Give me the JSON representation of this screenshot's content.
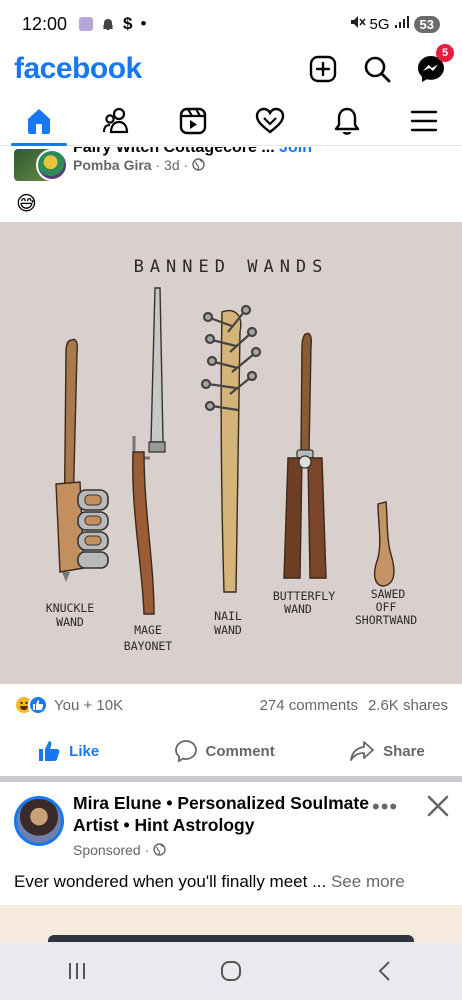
{
  "status_bar": {
    "time": "12:00",
    "dollar": "$",
    "dot": "•",
    "network": "5G",
    "battery": "53"
  },
  "header": {
    "logo": "facebook",
    "messenger_badge": "5"
  },
  "tabs": [
    "home",
    "friends",
    "video",
    "dating",
    "notifications",
    "menu"
  ],
  "post": {
    "group_name_cut": "Fairy Witch Cottagecore ...",
    "join_label": "Join",
    "author": "Pomba Gira",
    "time": "3d",
    "separator": "·",
    "emoji": "😅",
    "image_title": "BANNED   WANDS",
    "wands": [
      {
        "line1": "KNUCKLE",
        "line2": "WAND"
      },
      {
        "line1": "MAGE",
        "line2": "BAYONET"
      },
      {
        "line1": "NAIL",
        "line2": "WAND"
      },
      {
        "line1": "BUTTERFLY",
        "line2": "WAND"
      },
      {
        "line1": "SAWED",
        "line2": "OFF",
        "line3": "SHORTWAND"
      }
    ],
    "reactions_text": "You + 10K",
    "comments": "274 comments",
    "shares": "2.6K shares",
    "like_label": "Like",
    "comment_label": "Comment",
    "share_label": "Share"
  },
  "sponsored": {
    "name": "Mira Elune • Personalized Soulmate Artist • Hint Astrology",
    "sponsored_label": "Sponsored",
    "separator": "·",
    "more": "•••",
    "text": "Ever wondered when you'll finally meet ...",
    "see_more": "See more"
  },
  "colors": {
    "brand": "#1877f2",
    "badge": "#e41e3f",
    "image_bg": "#d9cfcc"
  }
}
